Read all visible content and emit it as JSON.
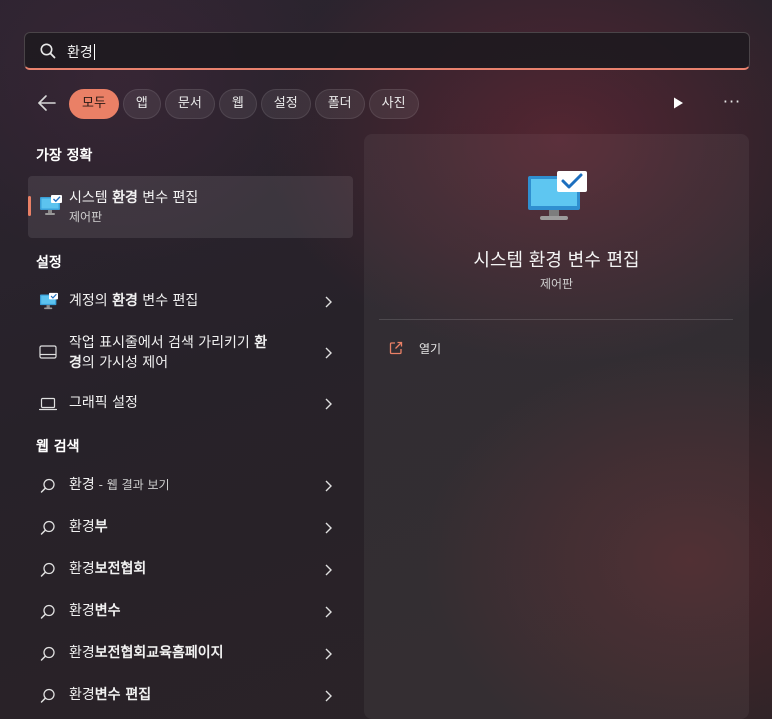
{
  "search": {
    "value": "환경"
  },
  "filters": [
    "모두",
    "앱",
    "문서",
    "웹",
    "설정",
    "폴더",
    "사진"
  ],
  "more_label": "···",
  "sections": {
    "best_match": "가장 정확",
    "settings": "설정",
    "web_search": "웹 검색"
  },
  "best_match": {
    "title_pre": "시스템 ",
    "title_bold": "환경",
    "title_post": " 변수 편집",
    "subtitle": "제어판",
    "icon": "system-monitor-icon"
  },
  "settings_items": [
    {
      "pre": "계정의 ",
      "bold": "환경",
      "post": " 변수 편집",
      "icon": "system-monitor-icon"
    },
    {
      "line1_pre": "작업 표시줄에서 검색 가리키기 ",
      "line1_bold": "환",
      "line2_bold": "경",
      "line2_post": "의 가시성 제어",
      "icon": "taskbar-icon"
    },
    {
      "pre": "그래픽 설정",
      "bold": "",
      "post": "",
      "icon": "laptop-icon"
    }
  ],
  "web_items": [
    {
      "pre": "환경",
      "bold": "",
      "small": " - 웹 결과 보기"
    },
    {
      "pre": "환경",
      "bold": "부",
      "small": ""
    },
    {
      "pre": "환경",
      "bold": "보전협회",
      "small": ""
    },
    {
      "pre": "환경",
      "bold": "변수",
      "small": ""
    },
    {
      "pre": "환경",
      "bold": "보전협회교육홈페이지",
      "small": ""
    },
    {
      "pre": "환경",
      "bold": "변수 편집",
      "small": ""
    }
  ],
  "preview": {
    "title": "시스템 환경 변수 편집",
    "subtitle": "제어판",
    "action_label": "열기",
    "action_icon": "open-external-icon"
  },
  "colors": {
    "accent": "#ea8066"
  }
}
